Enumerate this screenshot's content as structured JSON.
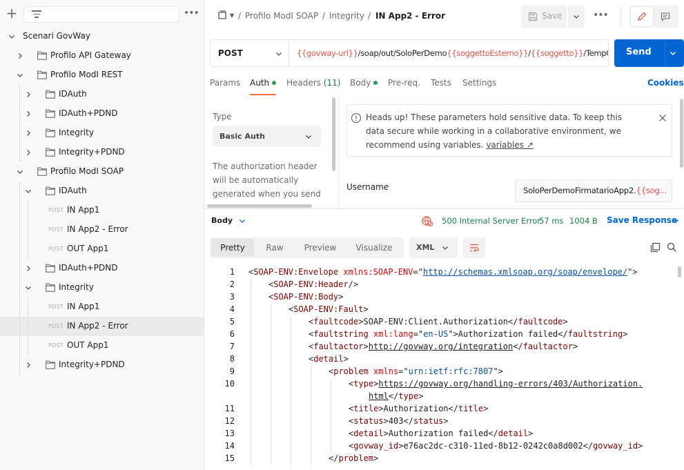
{
  "colors": {
    "accent": "#ff6c37",
    "primary": "#0265d2",
    "success": "#16824a",
    "variable": "#e05243",
    "tag": "#800000",
    "attr_name": "#e50000",
    "attr_value": "#0451a5"
  },
  "sidebar": {
    "add_icon": "plus-icon",
    "filter_icon": "filter-icon",
    "more_icon": "more-horizontal-icon",
    "tree": [
      {
        "label": "Scenari GovWay",
        "kind": "collection",
        "expanded": true
      },
      {
        "label": "Profilo API Gateway",
        "kind": "folder",
        "expanded": false
      },
      {
        "label": "Profilo ModI REST",
        "kind": "folder",
        "expanded": true
      },
      {
        "label": "IDAuth",
        "kind": "folder",
        "expanded": false
      },
      {
        "label": "IDAuth+PDND",
        "kind": "folder",
        "expanded": false
      },
      {
        "label": "Integrity",
        "kind": "folder",
        "expanded": false
      },
      {
        "label": "Integrity+PDND",
        "kind": "folder",
        "expanded": false
      },
      {
        "label": "Profilo ModI SOAP",
        "kind": "folder",
        "expanded": true
      },
      {
        "label": "IDAuth",
        "kind": "folder",
        "expanded": true
      },
      {
        "label": "IN App1",
        "kind": "request",
        "method": "POST"
      },
      {
        "label": "IN App2 - Error",
        "kind": "request",
        "method": "POST"
      },
      {
        "label": "OUT App1",
        "kind": "request",
        "method": "POST"
      },
      {
        "label": "IDAuth+PDND",
        "kind": "folder",
        "expanded": false
      },
      {
        "label": "Integrity",
        "kind": "folder",
        "expanded": true
      },
      {
        "label": "IN App1",
        "kind": "request",
        "method": "POST"
      },
      {
        "label": "IN App2 - Error",
        "kind": "request",
        "method": "POST",
        "selected": true
      },
      {
        "label": "OUT App1",
        "kind": "request",
        "method": "POST"
      },
      {
        "label": "Integrity+PDND",
        "kind": "folder",
        "expanded": false
      }
    ]
  },
  "header": {
    "breadcrumb": [
      "Profilo ModI SOAP",
      "Integrity",
      "IN App2 - Error"
    ],
    "separator": "/",
    "save_label": "Save",
    "more_label": "•••"
  },
  "request": {
    "method": "POST",
    "url_parts": [
      {
        "text": "{{govway-url}}",
        "var": true
      },
      {
        "text": "/soap/out/SoloPerDemo",
        "var": false
      },
      {
        "text": "{{soggettoEsterno}}",
        "var": true
      },
      {
        "text": "/",
        "var": false
      },
      {
        "text": "{{soggetto}}",
        "var": true
      },
      {
        "text": "/TempC",
        "var": false
      }
    ],
    "send_label": "Send",
    "tabs": [
      {
        "label": "Params"
      },
      {
        "label": "Auth",
        "dot": true,
        "active": true
      },
      {
        "label": "Headers",
        "count": "(11)"
      },
      {
        "label": "Body",
        "dot": true
      },
      {
        "label": "Pre-req."
      },
      {
        "label": "Tests"
      },
      {
        "label": "Settings"
      }
    ],
    "cookies_label": "Cookies"
  },
  "auth": {
    "type_label": "Type",
    "type_value": "Basic Auth",
    "help_text": "The authorization header will be automatically generated when you send",
    "alert_text": "Heads up! These parameters hold sensitive data. To keep this data secure while working in a collaborative environment, we recommend using variables.",
    "alert_link": "variables ↗",
    "username_label": "Username",
    "username_value": "SoloPerDemoFirmatarioApp2.",
    "username_var": "{{sog..."
  },
  "response": {
    "body_label": "Body",
    "status": "500 Internal Server Error",
    "time": "57 ms",
    "size": "1004 B",
    "save_label": "Save Response",
    "view_tabs": [
      {
        "label": "Pretty",
        "active": true
      },
      {
        "label": "Raw"
      },
      {
        "label": "Preview"
      },
      {
        "label": "Visualize"
      }
    ],
    "format": "XML",
    "lines": [
      {
        "n": "1",
        "indent": 0,
        "tokens": [
          [
            "p",
            "<"
          ],
          [
            "t",
            "SOAP-ENV:Envelope"
          ],
          [
            "p",
            " "
          ],
          [
            "a",
            "xmlns:SOAP-ENV"
          ],
          [
            "p",
            "=\""
          ],
          [
            "vu",
            "http://schemas.xmlsoap.org/soap/envelope/"
          ],
          [
            "p",
            "\""
          ],
          [
            "p",
            ">"
          ]
        ]
      },
      {
        "n": "2",
        "indent": 1,
        "tokens": [
          [
            "p",
            "<"
          ],
          [
            "t",
            "SOAP-ENV:Header"
          ],
          [
            "p",
            "/>"
          ]
        ]
      },
      {
        "n": "3",
        "indent": 1,
        "tokens": [
          [
            "p",
            "<"
          ],
          [
            "t",
            "SOAP-ENV:Body"
          ],
          [
            "p",
            ">"
          ]
        ]
      },
      {
        "n": "4",
        "indent": 2,
        "tokens": [
          [
            "p",
            "<"
          ],
          [
            "t",
            "SOAP-ENV:Fault"
          ],
          [
            "p",
            ">"
          ]
        ]
      },
      {
        "n": "5",
        "indent": 3,
        "tokens": [
          [
            "p",
            "<"
          ],
          [
            "t",
            "faultcode"
          ],
          [
            "p",
            ">"
          ],
          [
            "x",
            "SOAP-ENV:Client.Authorization"
          ],
          [
            "p",
            "</"
          ],
          [
            "t",
            "faultcode"
          ],
          [
            "p",
            ">"
          ]
        ]
      },
      {
        "n": "6",
        "indent": 3,
        "tokens": [
          [
            "p",
            "<"
          ],
          [
            "t",
            "faultstring"
          ],
          [
            "p",
            " "
          ],
          [
            "a",
            "xml:lang"
          ],
          [
            "p",
            "=\""
          ],
          [
            "v",
            "en-US"
          ],
          [
            "p",
            "\">"
          ],
          [
            "x",
            "Authorization failed"
          ],
          [
            "p",
            "</"
          ],
          [
            "t",
            "faultstring"
          ],
          [
            "p",
            ">"
          ]
        ]
      },
      {
        "n": "7",
        "indent": 3,
        "tokens": [
          [
            "p",
            "<"
          ],
          [
            "t",
            "faultactor"
          ],
          [
            "p",
            ">"
          ],
          [
            "xu",
            "http://govway.org/integration"
          ],
          [
            "p",
            "</"
          ],
          [
            "t",
            "faultactor"
          ],
          [
            "p",
            ">"
          ]
        ]
      },
      {
        "n": "8",
        "indent": 3,
        "tokens": [
          [
            "p",
            "<"
          ],
          [
            "t",
            "detail"
          ],
          [
            "p",
            ">"
          ]
        ]
      },
      {
        "n": "9",
        "indent": 4,
        "tokens": [
          [
            "p",
            "<"
          ],
          [
            "t",
            "problem"
          ],
          [
            "p",
            " "
          ],
          [
            "a",
            "xmlns"
          ],
          [
            "p",
            "=\""
          ],
          [
            "v",
            "urn:ietf:rfc:7807"
          ],
          [
            "p",
            "\">"
          ]
        ]
      },
      {
        "n": "10",
        "indent": 5,
        "tokens": [
          [
            "p",
            "<"
          ],
          [
            "t",
            "type"
          ],
          [
            "p",
            ">"
          ],
          [
            "xu",
            "https://govway.org/handling-errors/403/Authorization."
          ]
        ]
      },
      {
        "n": "",
        "indent": 5,
        "wrap": true,
        "tokens": [
          [
            "xu",
            "html"
          ],
          [
            "p",
            "</"
          ],
          [
            "t",
            "type"
          ],
          [
            "p",
            ">"
          ]
        ]
      },
      {
        "n": "11",
        "indent": 5,
        "tokens": [
          [
            "p",
            "<"
          ],
          [
            "t",
            "title"
          ],
          [
            "p",
            ">"
          ],
          [
            "x",
            "Authorization"
          ],
          [
            "p",
            "</"
          ],
          [
            "t",
            "title"
          ],
          [
            "p",
            ">"
          ]
        ]
      },
      {
        "n": "12",
        "indent": 5,
        "tokens": [
          [
            "p",
            "<"
          ],
          [
            "t",
            "status"
          ],
          [
            "p",
            ">"
          ],
          [
            "x",
            "403"
          ],
          [
            "p",
            "</"
          ],
          [
            "t",
            "status"
          ],
          [
            "p",
            ">"
          ]
        ]
      },
      {
        "n": "13",
        "indent": 5,
        "tokens": [
          [
            "p",
            "<"
          ],
          [
            "t",
            "detail"
          ],
          [
            "p",
            ">"
          ],
          [
            "x",
            "Authorization failed"
          ],
          [
            "p",
            "</"
          ],
          [
            "t",
            "detail"
          ],
          [
            "p",
            ">"
          ]
        ]
      },
      {
        "n": "14",
        "indent": 5,
        "tokens": [
          [
            "p",
            "<"
          ],
          [
            "t",
            "govway_id"
          ],
          [
            "p",
            ">"
          ],
          [
            "x",
            "e76ac2dc-c310-11ed-8b12-0242c0a8d002"
          ],
          [
            "p",
            "</"
          ],
          [
            "t",
            "govway_id"
          ],
          [
            "p",
            ">"
          ]
        ]
      },
      {
        "n": "15",
        "indent": 4,
        "tokens": [
          [
            "p",
            "</"
          ],
          [
            "t",
            "problem"
          ],
          [
            "p",
            ">"
          ]
        ]
      }
    ]
  }
}
